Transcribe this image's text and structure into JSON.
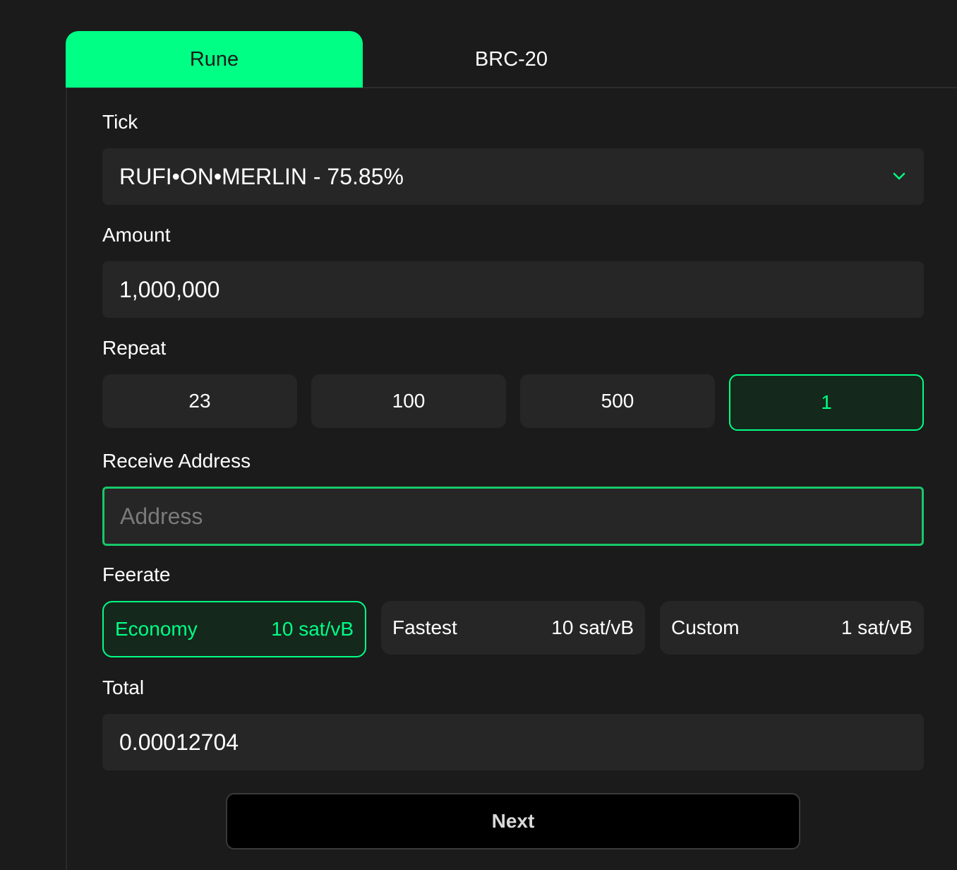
{
  "tabs": [
    {
      "label": "Rune",
      "active": true
    },
    {
      "label": "BRC-20",
      "active": false
    }
  ],
  "form": {
    "tick_label": "Tick",
    "tick_value": "RUFI•ON•MERLIN - 75.85%",
    "amount_label": "Amount",
    "amount_value": "1,000,000",
    "repeat_label": "Repeat",
    "repeat_options": [
      "23",
      "100",
      "500",
      "1"
    ],
    "repeat_selected": "1",
    "address_label": "Receive Address",
    "address_placeholder": "Address",
    "address_value": "",
    "feerate_label": "Feerate",
    "fee_options": [
      {
        "name": "Economy",
        "rate": "10 sat/vB",
        "selected": true
      },
      {
        "name": "Fastest",
        "rate": "10 sat/vB",
        "selected": false
      },
      {
        "name": "Custom",
        "rate": "1 sat/vB",
        "selected": false
      }
    ],
    "total_label": "Total",
    "total_value": "0.00012704",
    "next_label": "Next"
  },
  "colors": {
    "accent": "#00ff85",
    "background": "#1b1b1b",
    "field_bg": "#262626",
    "selected_bg": "#14281c"
  },
  "icons": {
    "tick_dropdown": "chevron-down-icon"
  }
}
